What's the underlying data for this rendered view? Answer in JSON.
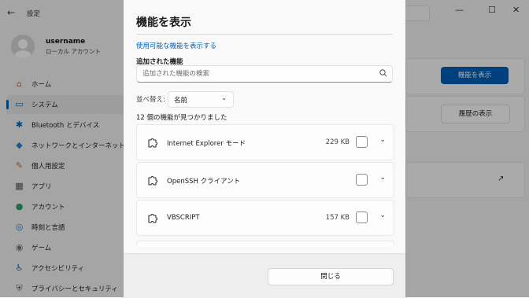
{
  "window": {
    "title": "設定",
    "back_glyph": "←",
    "minimize_glyph": "—",
    "maximize_glyph": "☐",
    "close_glyph": "✕"
  },
  "profile": {
    "username": "username",
    "account_type": "ローカル アカウント"
  },
  "sidebar": {
    "items": [
      {
        "label": "ホーム",
        "icon": "home-icon",
        "glyph": "⌂",
        "color": "#c0723e"
      },
      {
        "label": "システム",
        "icon": "system-icon",
        "glyph": "▭",
        "color": "#0067c0"
      },
      {
        "label": "Bluetooth とデバイス",
        "icon": "bluetooth-icon",
        "glyph": "✱",
        "color": "#0067c0"
      },
      {
        "label": "ネットワークとインターネット",
        "icon": "network-icon",
        "glyph": "◆",
        "color": "#2f80d6"
      },
      {
        "label": "個人用設定",
        "icon": "brush-icon",
        "glyph": "✎",
        "color": "#c56a2b"
      },
      {
        "label": "アプリ",
        "icon": "apps-icon",
        "glyph": "▦",
        "color": "#555555"
      },
      {
        "label": "アカウント",
        "icon": "account-icon",
        "glyph": "●",
        "color": "#2aa36b"
      },
      {
        "label": "時刻と言語",
        "icon": "globe-icon",
        "glyph": "◎",
        "color": "#2f80d6"
      },
      {
        "label": "ゲーム",
        "icon": "gamepad-icon",
        "glyph": "◉",
        "color": "#777777"
      },
      {
        "label": "アクセシビリティ",
        "icon": "accessibility-icon",
        "glyph": "♿",
        "color": "#1a6fc0"
      },
      {
        "label": "プライバシーとセキュリティ",
        "icon": "shield-icon",
        "glyph": "⛨",
        "color": "#666666"
      }
    ],
    "active_index": 1
  },
  "background": {
    "show_features_button": "機能を表示",
    "history_button": "履歴の表示",
    "accent": "#005fb8"
  },
  "dialog": {
    "title": "機能を表示",
    "available_link": "使用可能な機能を表示する",
    "added_heading": "追加された機能",
    "search_placeholder": "追加された機能の検索",
    "sort_label": "並べ替え:",
    "sort_value": "名前",
    "count_text": "12 個の機能が見つかりました",
    "features": [
      {
        "name": "Internet Explorer モード",
        "size": "229 KB"
      },
      {
        "name": "OpenSSH クライアント",
        "size": ""
      },
      {
        "name": "VBSCRIPT",
        "size": "157 KB"
      }
    ],
    "close_button": "閉じる"
  }
}
